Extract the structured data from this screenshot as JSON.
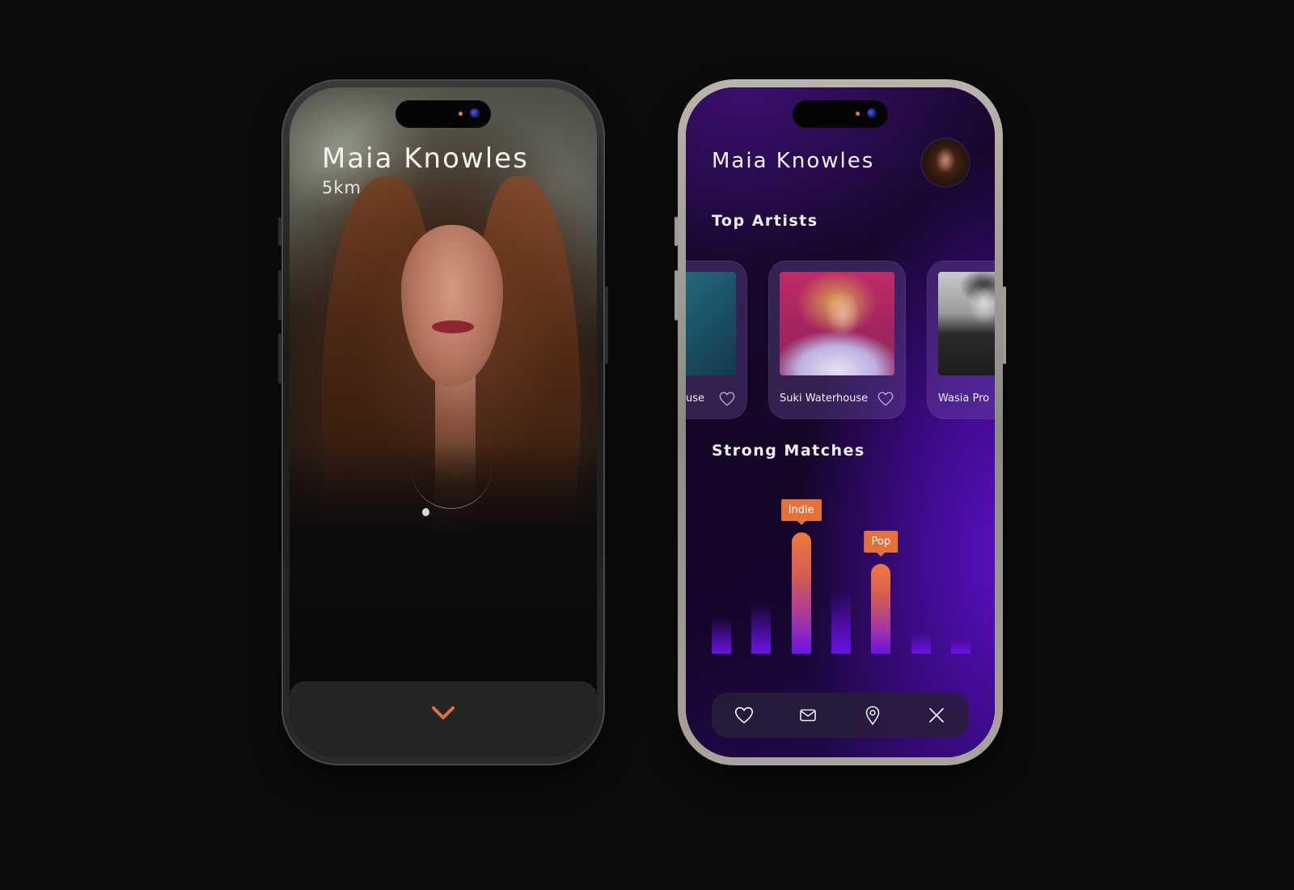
{
  "left_screen": {
    "profile_name": "Maia Knowles",
    "distance": "5km",
    "expand_icon": "chevron-down-icon",
    "accent_color": "#e2713a"
  },
  "right_screen": {
    "profile_name": "Maia Knowles",
    "avatar_icon": "profile-avatar",
    "top_artists": {
      "title": "Top Artists",
      "items": [
        {
          "label": "use",
          "liked": false
        },
        {
          "label": "Suki Waterhouse",
          "liked": false
        },
        {
          "label": "Wasia Pro",
          "liked": false
        }
      ]
    },
    "strong_matches": {
      "title": "Strong Matches"
    },
    "nav": {
      "items": [
        {
          "icon": "heart-icon"
        },
        {
          "icon": "mail-icon"
        },
        {
          "icon": "location-pin-icon"
        },
        {
          "icon": "close-icon"
        }
      ]
    },
    "accent_color": "#e2713a",
    "bar_color": "#6b12e6"
  },
  "chart_data": {
    "type": "bar",
    "categories": [
      "",
      "",
      "Indie",
      "",
      "Pop",
      "",
      ""
    ],
    "values": [
      30,
      42,
      100,
      52,
      74,
      18,
      12
    ],
    "annotations": [
      {
        "category_index": 2,
        "text": "Indie"
      },
      {
        "category_index": 4,
        "text": "Pop"
      }
    ],
    "title": "Strong Matches",
    "xlabel": "",
    "ylabel": "",
    "grid": false,
    "ylim": [
      0,
      100
    ]
  }
}
